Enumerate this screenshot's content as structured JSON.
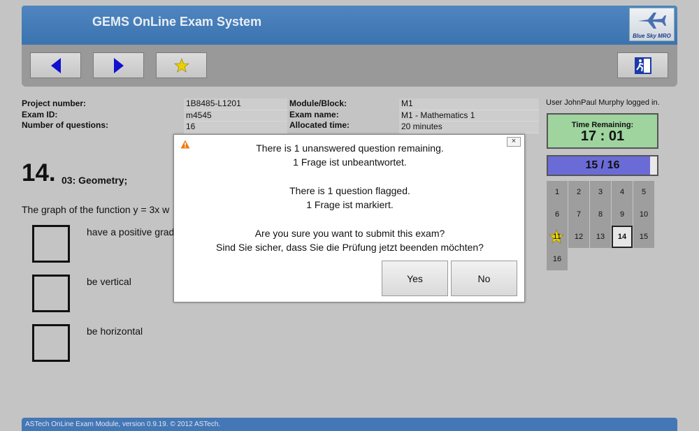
{
  "app": {
    "title": "GEMS OnLine Exam System",
    "logo_text": "Blue Sky MRO"
  },
  "toolbar": {
    "back_icon": "arrow-left-icon",
    "forward_icon": "arrow-right-icon",
    "flag_icon": "star-icon",
    "exit_icon": "exit-door-icon"
  },
  "exam_info": {
    "project_label": "Project number:",
    "project_value": "1B8485-L1201",
    "exam_id_label": "Exam ID:",
    "exam_id_value": "m4545",
    "num_q_label": "Number of questions:",
    "num_q_value": "16",
    "module_label": "Module/Block:",
    "module_value": "M1",
    "exam_name_label": "Exam name:",
    "exam_name_value": "M1 - Mathematics 1",
    "time_label": "Allocated time:",
    "time_value": "20 minutes"
  },
  "user": {
    "status": "User JohnPaul Murphy logged in."
  },
  "timer": {
    "label": "Time Remaining:",
    "value": "17 : 01"
  },
  "progress": {
    "text": "15 / 16",
    "fraction": 0.9375
  },
  "question_grid": {
    "numbers": [
      "1",
      "2",
      "3",
      "4",
      "5",
      "6",
      "7",
      "8",
      "9",
      "10",
      "11",
      "12",
      "13",
      "14",
      "15",
      "16"
    ],
    "flagged": "11",
    "current": "14"
  },
  "question": {
    "number": "14.",
    "topic": "03: Geometry;",
    "text": "The graph of the function y = 3x w",
    "answers": [
      "have a positive grad",
      "be vertical",
      "be horizontal"
    ]
  },
  "dialog": {
    "line1": "There is 1 unanswered question remaining.",
    "line2": "1 Frage ist unbeantwortet.",
    "line3": "There is 1 question flagged.",
    "line4": "1 Frage ist markiert.",
    "line5": "Are you sure you want to submit this exam?",
    "line6": "Sind Sie sicher, dass Sie die Prüfung jetzt beenden möchten?",
    "yes_label": "Yes",
    "no_label": "No",
    "close_label": "×"
  },
  "footer": {
    "text": "ASTech OnLine Exam Module, version 0.9.19. © 2012 ASTech."
  },
  "colors": {
    "header": "#3b73b0",
    "timer_bg": "#9fd49f",
    "progress_fill": "#6b6bd8",
    "arrow": "#1010d0",
    "star": "#e8d000"
  }
}
